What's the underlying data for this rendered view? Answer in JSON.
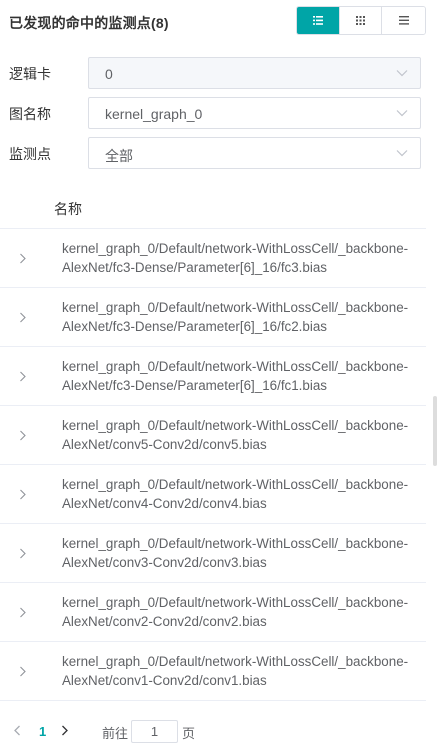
{
  "header": {
    "title": "已发现的命中的监测点(8)",
    "view_modes": [
      "list-detail-icon",
      "grid-icon",
      "list-icon"
    ],
    "active_view": 0
  },
  "filters": [
    {
      "label": "逻辑卡",
      "value": "0",
      "disabled": true
    },
    {
      "label": "图名称",
      "value": "kernel_graph_0",
      "disabled": false
    },
    {
      "label": "监测点",
      "value": "全部",
      "disabled": false
    }
  ],
  "list": {
    "column_header": "名称",
    "items": [
      "kernel_graph_0/Default/network-WithLossCell/_backbone-AlexNet/fc3-Dense/Parameter[6]_16/fc3.bias",
      "kernel_graph_0/Default/network-WithLossCell/_backbone-AlexNet/fc3-Dense/Parameter[6]_16/fc2.bias",
      "kernel_graph_0/Default/network-WithLossCell/_backbone-AlexNet/fc3-Dense/Parameter[6]_16/fc1.bias",
      "kernel_graph_0/Default/network-WithLossCell/_backbone-AlexNet/conv5-Conv2d/conv5.bias",
      "kernel_graph_0/Default/network-WithLossCell/_backbone-AlexNet/conv4-Conv2d/conv4.bias",
      "kernel_graph_0/Default/network-WithLossCell/_backbone-AlexNet/conv3-Conv2d/conv3.bias",
      "kernel_graph_0/Default/network-WithLossCell/_backbone-AlexNet/conv2-Conv2d/conv2.bias",
      "kernel_graph_0/Default/network-WithLossCell/_backbone-AlexNet/conv1-Conv2d/conv1.bias"
    ]
  },
  "pagination": {
    "current_page": "1",
    "goto_label": "前往",
    "goto_value": "1",
    "page_unit": "页"
  },
  "colors": {
    "accent": "#00a5a7",
    "border": "#dcdfe6",
    "text": "#606266"
  }
}
